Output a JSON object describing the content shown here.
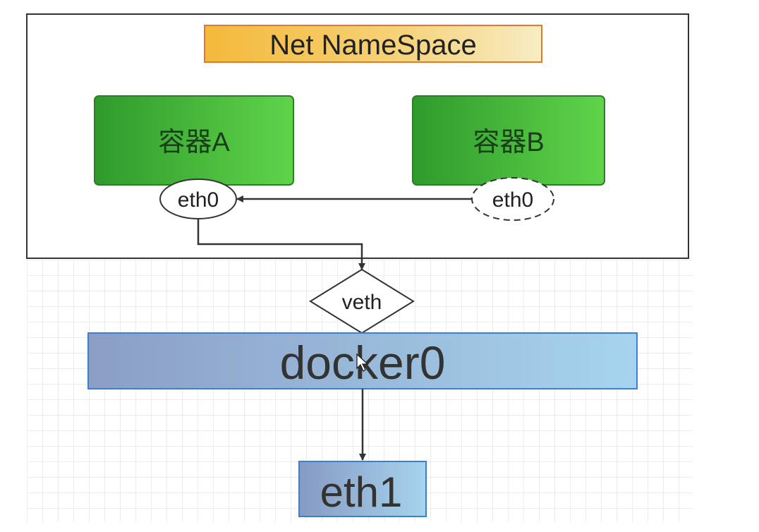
{
  "namespace": {
    "title": "Net NameSpace"
  },
  "containers": [
    {
      "label": "容器A",
      "iface": "eth0"
    },
    {
      "label": "容器B",
      "iface": "eth0"
    }
  ],
  "veth": {
    "label": "veth"
  },
  "bridge": {
    "label": "docker0"
  },
  "host_iface": {
    "label": "eth1"
  },
  "colors": {
    "container_green": "#3fb53a",
    "title_orange": "#f6c23e",
    "bridge_blue": "#8fb4dc",
    "border_blue": "#3a7fd4"
  }
}
